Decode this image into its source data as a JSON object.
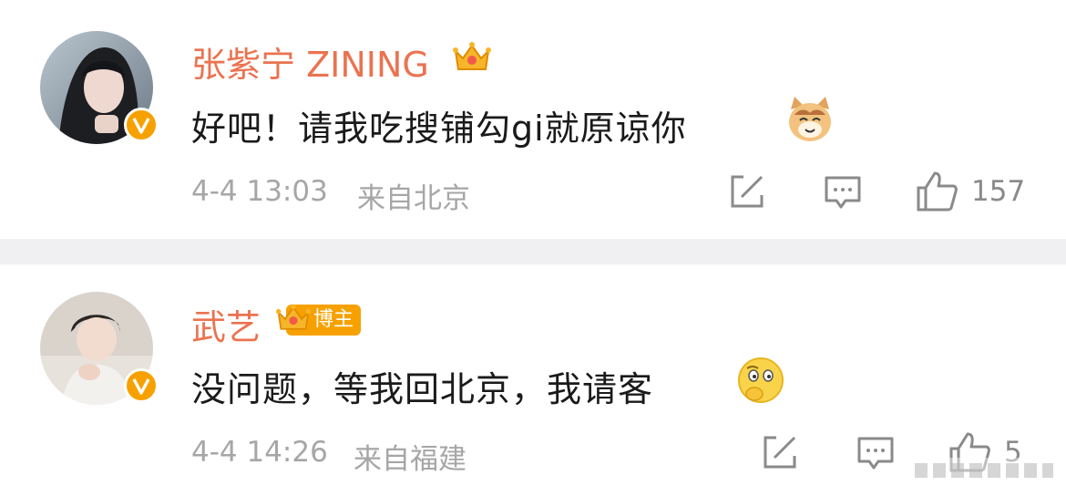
{
  "comments": [
    {
      "username": "张紫宁 ZINING",
      "text": "好吧！请我吃搜铺勾gi就原谅你",
      "time": "4-4 13:03",
      "location": "来自北京",
      "likes": "157",
      "emoji": "cat-emoji"
    },
    {
      "username": "武艺",
      "badge_tag": "博主",
      "text": "没问题，等我回北京，我请客",
      "time": "4-4 14:26",
      "location": "来自福建",
      "likes": "5",
      "emoji": "thinking-emoji"
    }
  ],
  "colors": {
    "name": "#eb7350",
    "accent": "#f7a100",
    "meta": "#a6a6a6"
  }
}
